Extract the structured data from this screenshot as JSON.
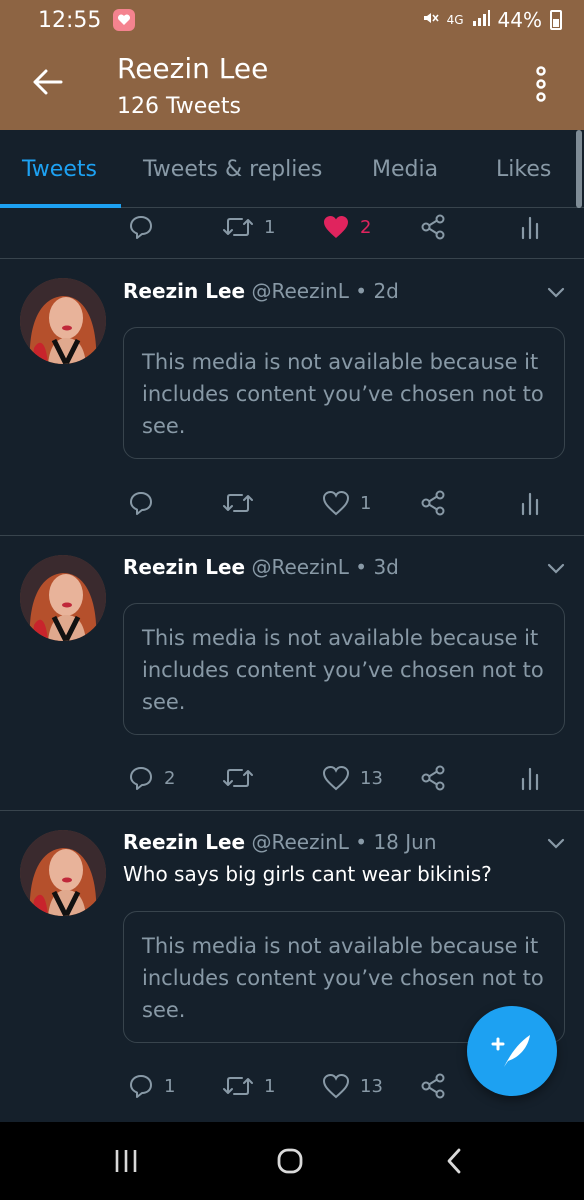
{
  "status_bar": {
    "time": "12:55",
    "network": "4G",
    "battery_text": "44%"
  },
  "header": {
    "title": "Reezin Lee",
    "subtitle": "126 Tweets"
  },
  "tabs": [
    {
      "label": "Tweets",
      "active": true
    },
    {
      "label": "Tweets & replies",
      "active": false
    },
    {
      "label": "Media",
      "active": false
    },
    {
      "label": "Likes",
      "active": false
    }
  ],
  "top_actions": {
    "reply_count": "",
    "retweet_count": "1",
    "like_count": "2"
  },
  "tweets": [
    {
      "name": "Reezin Lee",
      "meta": "@ReezinL • 2d",
      "text": "",
      "media_notice": "This media is not available because it includes content you’ve chosen not to see.",
      "reply_count": "",
      "retweet_count": "",
      "like_count": "1"
    },
    {
      "name": "Reezin Lee",
      "meta": "@ReezinL • 3d",
      "text": "",
      "media_notice": "This media is not available because it includes content you’ve chosen not to see.",
      "reply_count": "2",
      "retweet_count": "",
      "like_count": "13"
    },
    {
      "name": "Reezin Lee",
      "meta": "@ReezinL • 18 Jun",
      "text": "Who says big girls cant wear bikinis?",
      "media_notice": "This media is not available because it includes content you’ve chosen not to see.",
      "reply_count": "1",
      "retweet_count": "1",
      "like_count": "13"
    }
  ],
  "colors": {
    "header_bg": "#8d6443",
    "background": "#15202b",
    "accent": "#1da1f2",
    "like": "#e0245e",
    "muted": "#8899a6",
    "border": "#38444d"
  },
  "icons": [
    "back-arrow-icon",
    "more-vertical-icon",
    "reply-icon",
    "retweet-icon",
    "heart-icon",
    "share-icon",
    "analytics-icon",
    "chevron-down-icon",
    "compose-tweet-icon",
    "recent-apps-icon",
    "home-icon",
    "nav-back-icon"
  ]
}
